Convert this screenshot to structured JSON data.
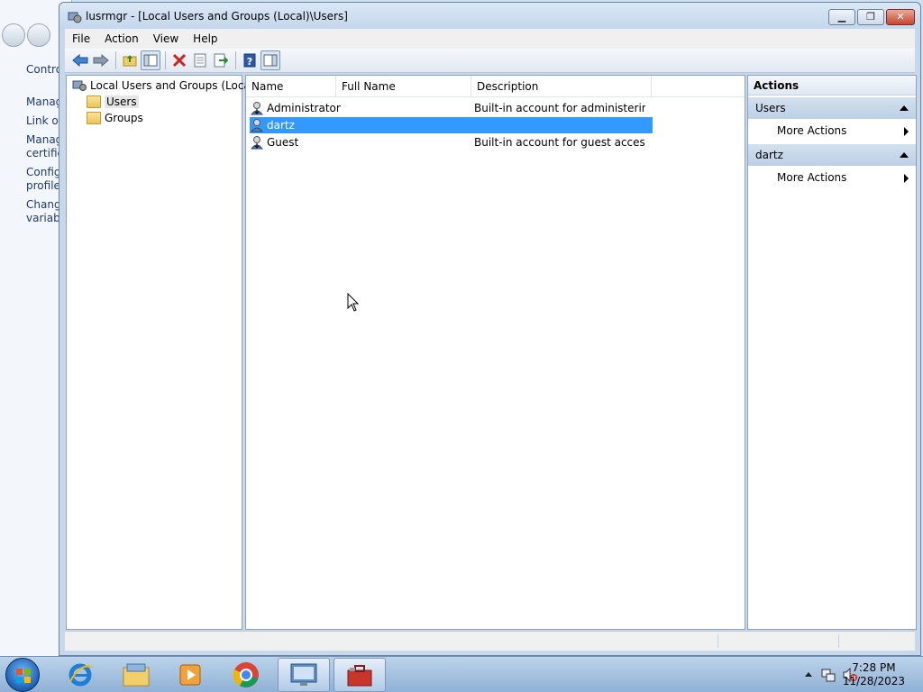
{
  "background": {
    "links": [
      "Contro",
      "Manag",
      "Link or",
      "Manag certific",
      "Config profile",
      "Chang variabl"
    ]
  },
  "window": {
    "title": "lusrmgr - [Local Users and Groups (Local)\\Users]",
    "minimize_icon": "minimize-icon",
    "maximize_icon": "maximize-icon",
    "close_icon": "close-icon"
  },
  "menu": {
    "items": [
      "File",
      "Action",
      "View",
      "Help"
    ]
  },
  "toolbar": {
    "icons": [
      "back-arrow-icon",
      "forward-arrow-icon",
      "up-folder-icon",
      "show-hide-tree-icon",
      "delete-icon",
      "properties-icon",
      "export-list-icon",
      "help-icon",
      "show-hide-action-pane-icon"
    ]
  },
  "tree": {
    "root": "Local Users and Groups (Local)",
    "items": [
      "Users",
      "Groups"
    ]
  },
  "list": {
    "columns": [
      "Name",
      "Full Name",
      "Description"
    ],
    "rows": [
      {
        "name": "Administrator",
        "full_name": "",
        "description": "Built-in account for administering..."
      },
      {
        "name": "dartz",
        "full_name": "",
        "description": ""
      },
      {
        "name": "Guest",
        "full_name": "",
        "description": "Built-in account for guest access t..."
      }
    ],
    "selected": "dartz"
  },
  "actions": {
    "title": "Actions",
    "sections": [
      {
        "header": "Users",
        "items": [
          "More Actions"
        ]
      },
      {
        "header": "dartz",
        "items": [
          "More Actions"
        ]
      }
    ]
  },
  "taskbar": {
    "apps": [
      "internet-explorer",
      "file-explorer",
      "media-player",
      "chrome",
      "remote-desktop",
      "toolbox"
    ],
    "time": "7:28 PM",
    "date": "11/28/2023"
  }
}
